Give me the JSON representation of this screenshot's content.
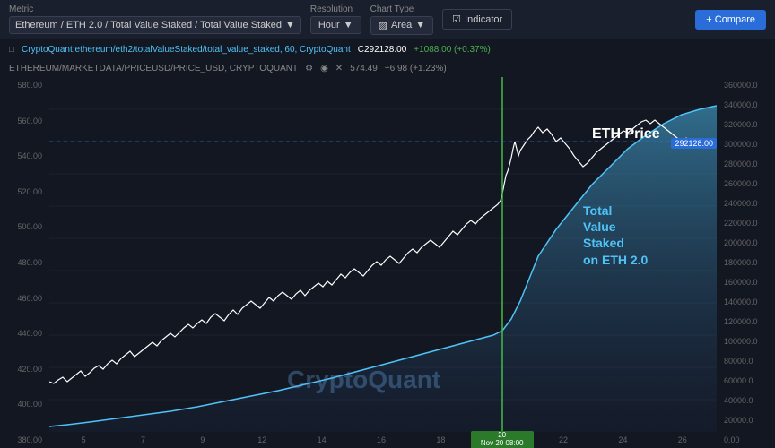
{
  "topbar": {
    "metric_label": "Metric",
    "metric_value": "Ethereum / ETH 2.0 / Total Value Staked / Total Value Staked",
    "resolution_label": "Resolution",
    "resolution_value": "Hour",
    "chart_type_label": "Chart Type",
    "chart_type_value": "Area",
    "chart_type_icon": "▨",
    "indicator_label": "Indicator",
    "compare_label": "+ Compare"
  },
  "chart": {
    "source_line1": "CryptoQuant:ethereum/eth2/totalValueStaked/total_value_staked, 60, CryptoQuant",
    "source_icon": "□",
    "price_current": "C292128.00",
    "price_change": "+1088.00 (+0.37%)",
    "source_line2": "ETHEREUM/MARKETDATA/PRICEUSD/PRICE_USD, CRYPTOQUANT",
    "price2": "574.49",
    "change2": "+6.98 (+1.23%)",
    "left_axis": [
      "580.00",
      "560.00",
      "540.00",
      "520.00",
      "500.00",
      "480.00",
      "460.00",
      "440.00",
      "420.00",
      "400.00",
      "380.00"
    ],
    "right_axis": [
      "360000.0",
      "340000.0",
      "320000.0",
      "300000.0",
      "280000.0",
      "260000.0",
      "240000.0",
      "220000.0",
      "200000.0",
      "180000.0",
      "160000.0",
      "140000.0",
      "120000.0",
      "100000.0",
      "80000.0",
      "60000.0",
      "40000.0",
      "20000.0",
      "0.00"
    ],
    "x_labels": [
      "5",
      "7",
      "9",
      "12",
      "14",
      "16",
      "18",
      "20 Nov 20 08:00",
      "22",
      "24",
      "26"
    ],
    "x_highlight": "20 Nov 20\n08:00",
    "price_badge": "292128.00",
    "annotation_eth": "ETH Price",
    "annotation_tvs": "Total\nValue\nStaked\non ETH 2.0",
    "annotation_cq": "CryptoQuant"
  }
}
